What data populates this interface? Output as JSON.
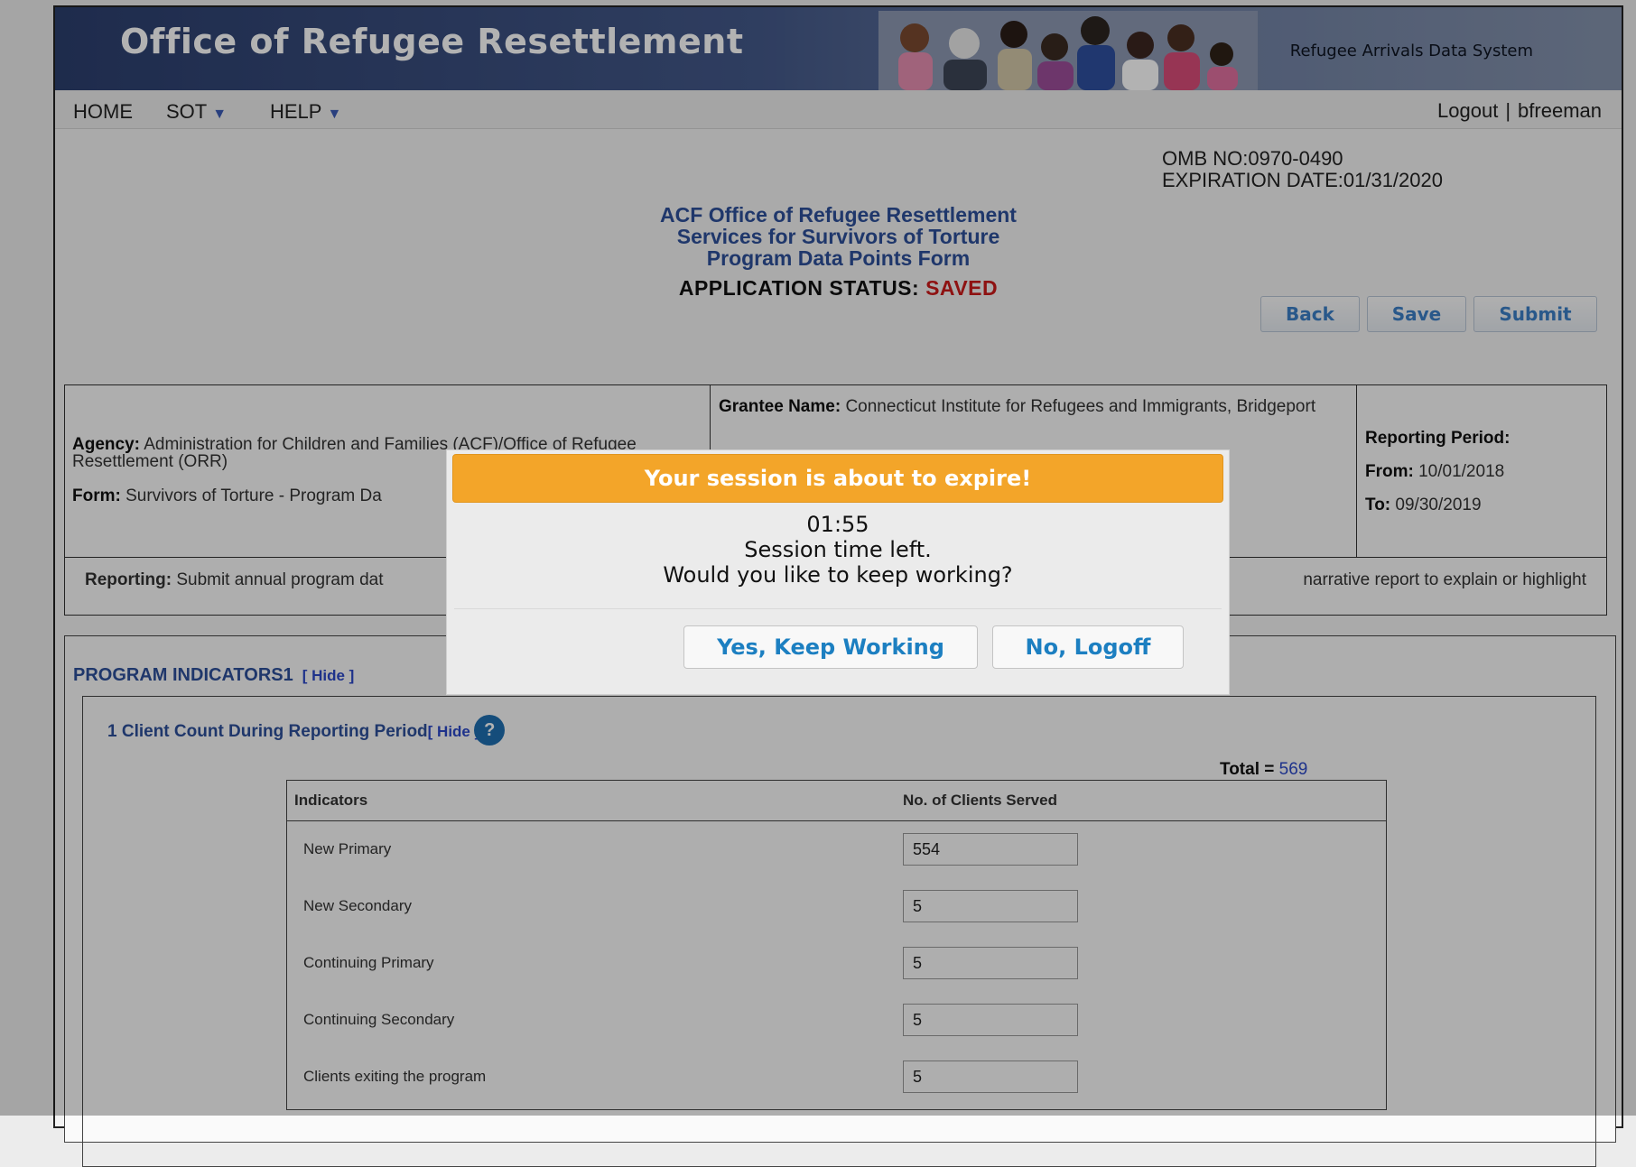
{
  "header": {
    "title": "Office of Refugee Resettlement",
    "system_name": "Refugee Arrivals Data System"
  },
  "nav": {
    "home": "HOME",
    "sot": "SOT",
    "help": "HELP",
    "logout": "Logout",
    "separator": "|",
    "username": "bfreeman"
  },
  "omb": {
    "number": "OMB NO:0970-0490",
    "expiration": "EXPIRATION DATE:01/31/2020"
  },
  "form": {
    "title_line1": "ACF Office of Refugee Resettlement",
    "title_line2": "Services for Survivors of Torture",
    "title_line3": "Program Data Points Form",
    "status_label": "APPLICATION STATUS:",
    "status_value": "SAVED"
  },
  "buttons": {
    "back": "Back",
    "save": "Save",
    "submit": "Submit"
  },
  "info": {
    "agency_label": "Agency:",
    "agency_value": "Administration for Children and Families (ACF)/Office of Refugee Resettlement (ORR)",
    "form_label": "Form:",
    "form_value": "Survivors of Torture - Program Da",
    "grantee_label": "Grantee Name:",
    "grantee_value": "Connecticut Institute for Refugees and Immigrants, Bridgeport",
    "reporting_period_label": "Reporting Period:",
    "from_label": "From:",
    "from_value": "10/01/2018",
    "to_label": "To:",
    "to_value": "09/30/2019",
    "reporting_label": "Reporting:",
    "reporting_value_left": "Submit annual program dat",
    "reporting_value_right": "narrative report to explain or highlight"
  },
  "program_indicators": {
    "title": "PROGRAM INDICATORS1",
    "hide": "[ Hide ]",
    "section_title": "1  Client Count During Reporting Period",
    "section_hide": "[ Hide ]",
    "help_icon": "question-icon",
    "total_label": "Total =",
    "total_value": "569",
    "col_indicators": "Indicators",
    "col_clients": "No. of Clients Served",
    "rows": [
      {
        "label": "New Primary",
        "value": "554"
      },
      {
        "label": "New Secondary",
        "value": "5"
      },
      {
        "label": "Continuing Primary",
        "value": "5"
      },
      {
        "label": "Continuing Secondary",
        "value": "5"
      },
      {
        "label": "Clients exiting the program",
        "value": "5"
      }
    ]
  },
  "modal": {
    "title": "Your session is about to expire!",
    "countdown": "01:55",
    "line1": "Session time left.",
    "line2": "Would you like to keep working?",
    "yes": "Yes, Keep Working",
    "no": "No, Logoff"
  },
  "colors": {
    "banner": "#2c3f6e",
    "link_blue": "#2d4f9a",
    "saved_red": "#cc1a1a",
    "modal_header": "#f3a529",
    "modal_button_text": "#1c7fc1"
  }
}
